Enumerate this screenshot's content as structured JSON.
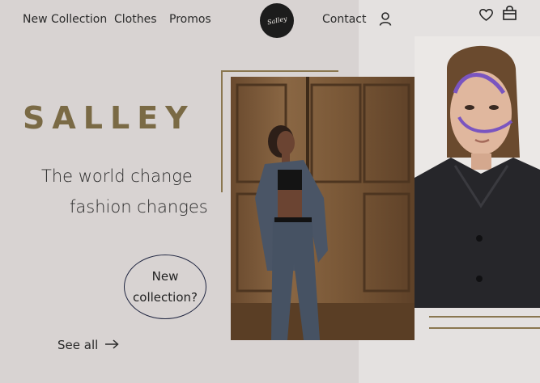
{
  "nav": {
    "left": [
      "New Collection",
      "Clothes",
      "Promos"
    ],
    "contact": "Contact"
  },
  "logo": {
    "text": "Salley"
  },
  "icons": {
    "user": "user-icon",
    "heart": "heart-icon",
    "bag": "shopping-bag-icon",
    "arrow": "arrow-right-icon"
  },
  "hero": {
    "brand": "SALLEY",
    "tagline_line1": "The world change",
    "tagline_line2": "fashion changes",
    "cta_line1": "New",
    "cta_line2": "collection?",
    "see_all": "See all"
  },
  "colors": {
    "background": "#d8d3d2",
    "brand": "#7a6a45",
    "accent_line": "#8a7750",
    "oval_border": "#1f2540"
  }
}
